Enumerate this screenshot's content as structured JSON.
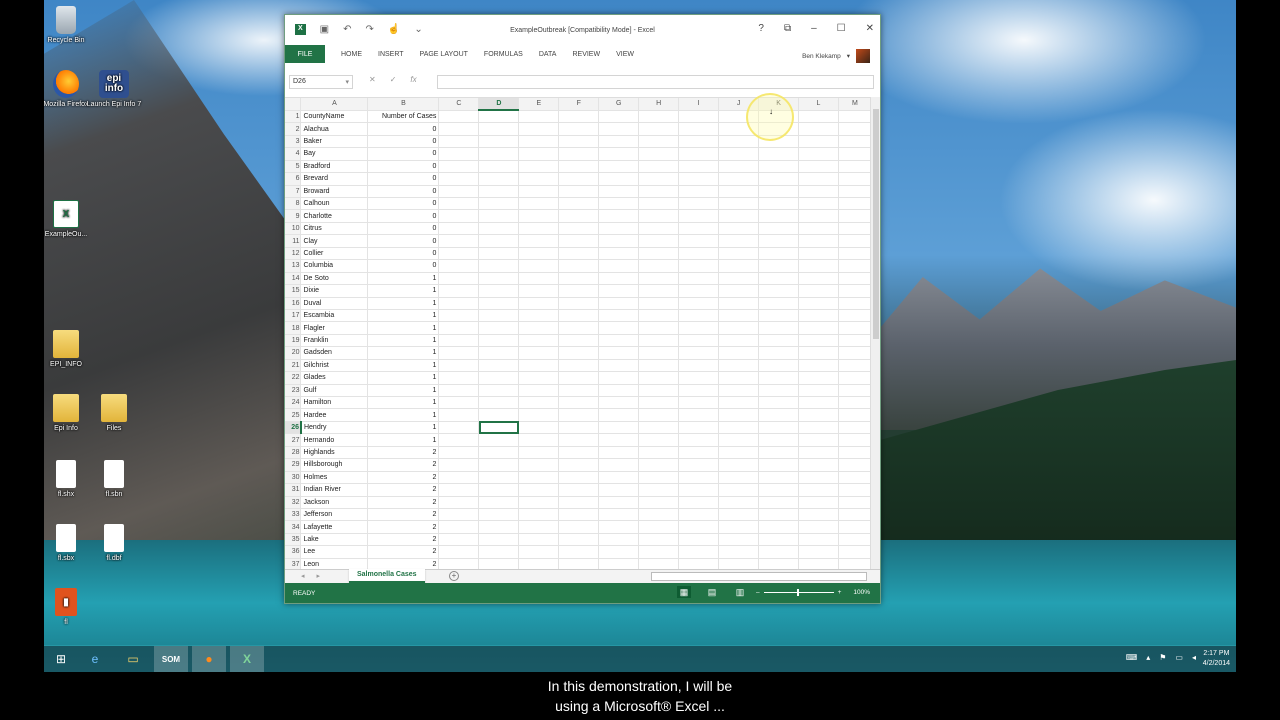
{
  "desktop": {
    "icons": [
      {
        "label": "Recycle Bin",
        "icon": "recycle-bin-icon"
      },
      {
        "label": "Mozilla Firefox",
        "icon": "firefox-icon"
      },
      {
        "label": "Launch Epi Info 7",
        "icon": "epi-info-icon",
        "glyph": "epi info"
      },
      {
        "label": "ExampleOu...",
        "icon": "excel-file-icon",
        "glyph": "X"
      },
      {
        "label": "EPI_INFO",
        "icon": "folder-icon"
      },
      {
        "label": "Epi Info",
        "icon": "folder-icon"
      },
      {
        "label": "Files",
        "icon": "folder-icon"
      },
      {
        "label": "fl.shx",
        "icon": "file-icon"
      },
      {
        "label": "fl.sbn",
        "icon": "file-icon"
      },
      {
        "label": "fl.sbx",
        "icon": "file-icon"
      },
      {
        "label": "fl.dbf",
        "icon": "file-icon"
      },
      {
        "label": "fl",
        "icon": "office-icon"
      }
    ]
  },
  "excel": {
    "title": "ExampleOutbreak  [Compatibility Mode] - Excel",
    "logo": "X",
    "ribbon_tabs": [
      "FILE",
      "HOME",
      "INSERT",
      "PAGE LAYOUT",
      "FORMULAS",
      "DATA",
      "REVIEW",
      "VIEW"
    ],
    "user": "Ben Klekamp",
    "name_box": "D26",
    "formula_value": "",
    "columns": [
      "A",
      "B",
      "C",
      "D",
      "E",
      "F",
      "G",
      "H",
      "I",
      "J",
      "K",
      "L",
      "M"
    ],
    "selected_column": "D",
    "selected_row": 26,
    "headers": [
      "CountyName",
      "Number of Cases"
    ],
    "rows": [
      [
        "Alachua",
        "0"
      ],
      [
        "Baker",
        "0"
      ],
      [
        "Bay",
        "0"
      ],
      [
        "Bradford",
        "0"
      ],
      [
        "Brevard",
        "0"
      ],
      [
        "Broward",
        "0"
      ],
      [
        "Calhoun",
        "0"
      ],
      [
        "Charlotte",
        "0"
      ],
      [
        "Citrus",
        "0"
      ],
      [
        "Clay",
        "0"
      ],
      [
        "Collier",
        "0"
      ],
      [
        "Columbia",
        "0"
      ],
      [
        "De Soto",
        "1"
      ],
      [
        "Dixie",
        "1"
      ],
      [
        "Duval",
        "1"
      ],
      [
        "Escambia",
        "1"
      ],
      [
        "Flagler",
        "1"
      ],
      [
        "Franklin",
        "1"
      ],
      [
        "Gadsden",
        "1"
      ],
      [
        "Gilchrist",
        "1"
      ],
      [
        "Glades",
        "1"
      ],
      [
        "Gulf",
        "1"
      ],
      [
        "Hamilton",
        "1"
      ],
      [
        "Hardee",
        "1"
      ],
      [
        "Hendry",
        "1"
      ],
      [
        "Hernando",
        "1"
      ],
      [
        "Highlands",
        "2"
      ],
      [
        "Hillsborough",
        "2"
      ],
      [
        "Holmes",
        "2"
      ],
      [
        "Indian River",
        "2"
      ],
      [
        "Jackson",
        "2"
      ],
      [
        "Jefferson",
        "2"
      ],
      [
        "Lafayette",
        "2"
      ],
      [
        "Lake",
        "2"
      ],
      [
        "Lee",
        "2"
      ],
      [
        "Leon",
        "2"
      ]
    ],
    "sheet_tab": "Salmonella Cases",
    "status": "READY",
    "zoom": "100%"
  },
  "taskbar": {
    "apps": [
      "windows-start-icon",
      "internet-explorer-icon",
      "file-explorer-icon",
      "som-icon",
      "firefox-icon",
      "excel-icon"
    ],
    "som_label": "SOM",
    "time": "2:17 PM",
    "date": "4/2/2014"
  },
  "captions": {
    "line1": "In this demonstration, I will be",
    "line2": "using a Microsoft® Excel ..."
  }
}
